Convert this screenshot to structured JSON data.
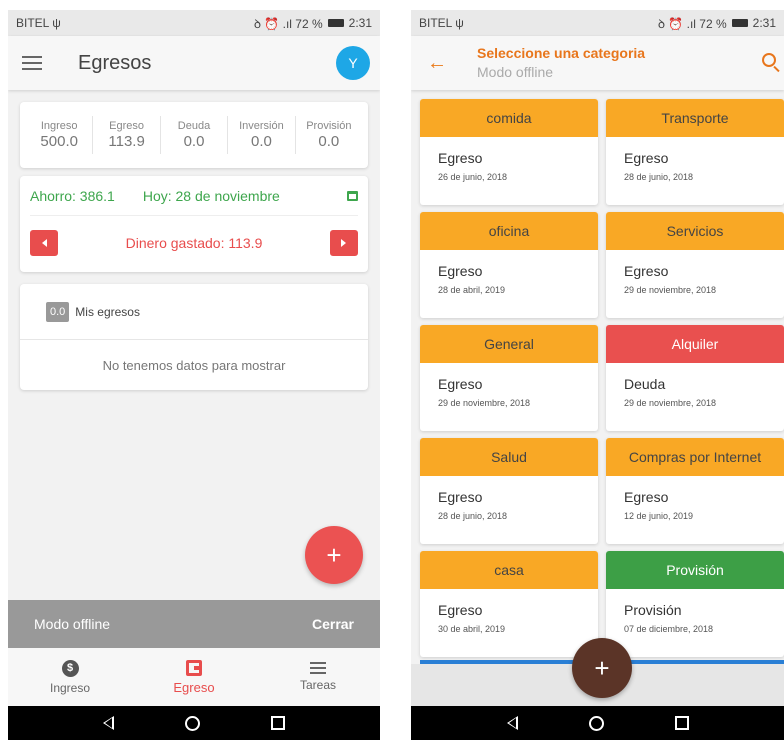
{
  "status_left": {
    "carrier": "BITEL ψ",
    "indicators": "ꝺ ⏰ .ıl 72 %",
    "battery_icon": "battery-icon",
    "time": "2:31"
  },
  "status_right": {
    "carrier": "BITEL ψ",
    "indicators": "ꝺ ⏰ .ıl 72 %",
    "battery_icon": "battery-icon",
    "time": "2:31"
  },
  "left": {
    "appbar": {
      "title": "Egresos",
      "avatar": "Y"
    },
    "summary": [
      {
        "label": "Ingreso",
        "value": "500.0"
      },
      {
        "label": "Egreso",
        "value": "113.9"
      },
      {
        "label": "Deuda",
        "value": "0.0"
      },
      {
        "label": "Inversión",
        "value": "0.0"
      },
      {
        "label": "Provisión",
        "value": "0.0"
      }
    ],
    "ahorro": {
      "text": "Ahorro: 386.1",
      "hoy": "Hoy: 28 de noviembre",
      "gastado": "Dinero gastado: 113.9"
    },
    "egresos": {
      "badge": "0.0",
      "title": "Mis egresos",
      "empty": "No tenemos datos para mostrar"
    },
    "fab": "+",
    "offline": {
      "text": "Modo offline",
      "close": "Cerrar"
    },
    "nav": [
      {
        "label": "Ingreso",
        "icon": "dollar-icon"
      },
      {
        "label": "Egreso",
        "icon": "wallet-icon"
      },
      {
        "label": "Tareas",
        "icon": "list-icon"
      }
    ],
    "nav_glyphs": {
      "dollar": "$"
    }
  },
  "right": {
    "appbar": {
      "title": "Seleccione una categoria",
      "subtitle": "Modo offline",
      "back": "←"
    },
    "categories": [
      {
        "name": "comida",
        "type": "Egreso",
        "date": "26 de junio, 2018",
        "color": "#f9a825"
      },
      {
        "name": "Transporte",
        "type": "Egreso",
        "date": "28 de junio, 2018",
        "color": "#f9a825"
      },
      {
        "name": "oficina",
        "type": "Egreso",
        "date": "28 de abril, 2019",
        "color": "#f9a825"
      },
      {
        "name": "Servicios",
        "type": "Egreso",
        "date": "29 de noviembre, 2018",
        "color": "#f9a825"
      },
      {
        "name": "General",
        "type": "Egreso",
        "date": "29 de noviembre, 2018",
        "color": "#f9a825"
      },
      {
        "name": "Alquiler",
        "type": "Deuda",
        "date": "29 de noviembre, 2018",
        "color": "#e9504f"
      },
      {
        "name": "Salud",
        "type": "Egreso",
        "date": "28 de junio, 2018",
        "color": "#f9a825"
      },
      {
        "name": "Compras por Internet",
        "type": "Egreso",
        "date": "12 de junio, 2019",
        "color": "#f9a825"
      },
      {
        "name": "casa",
        "type": "Egreso",
        "date": "30 de abril, 2019",
        "color": "#f9a825"
      },
      {
        "name": "Provisión",
        "type": "Provisión",
        "date": "07 de diciembre, 2018",
        "color": "#3d9f46"
      }
    ],
    "fab": "+"
  },
  "colors": {
    "accent_red": "#e84d4d",
    "accent_orange": "#e8761c",
    "green": "#3ea64d",
    "blue": "#1ea7e6"
  }
}
